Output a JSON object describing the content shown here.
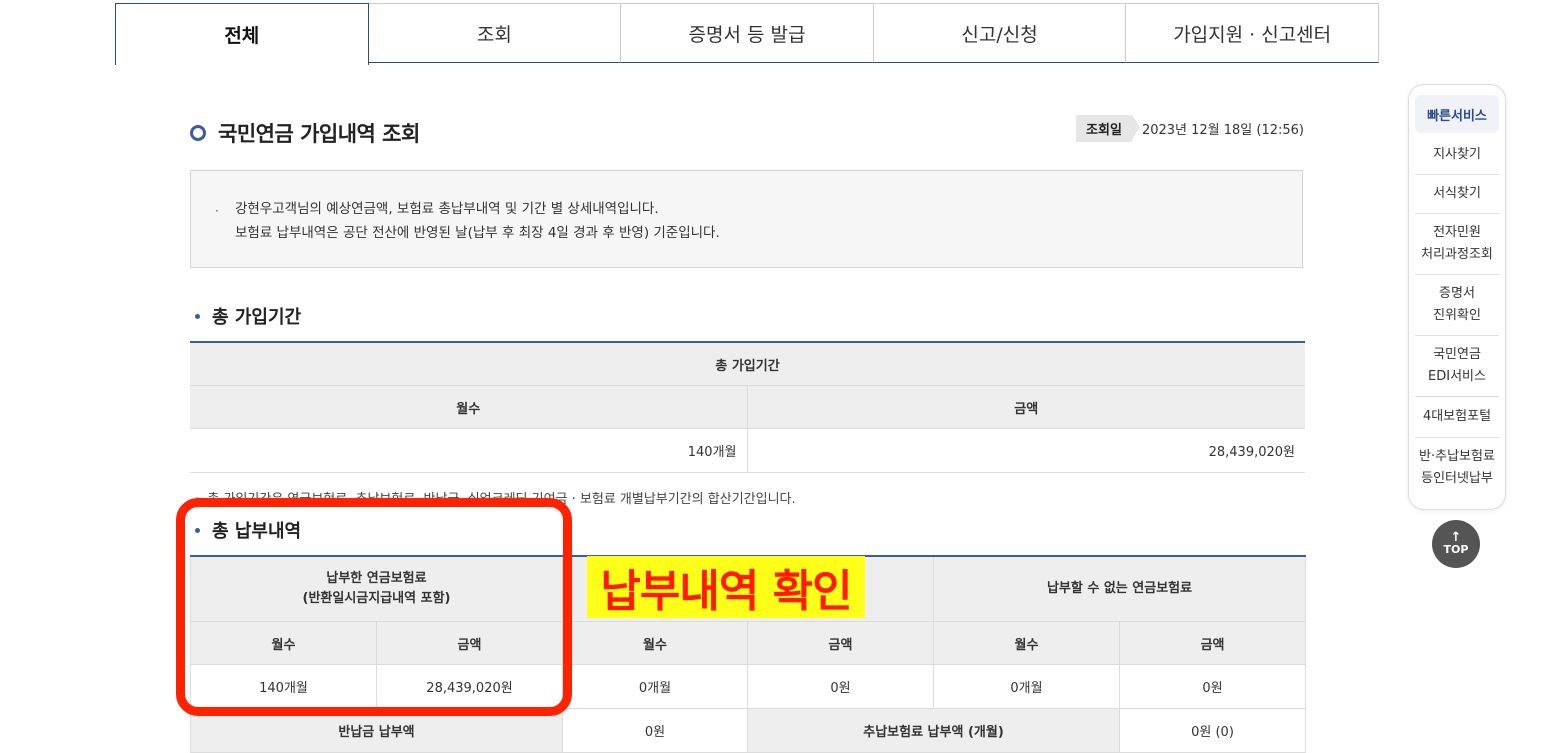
{
  "tabs": [
    "전체",
    "조회",
    "증명서 등 발급",
    "신고/신청",
    "가입지원 · 신고센터"
  ],
  "page_title": "국민연금 가입내역 조회",
  "date": {
    "badge": "조회일",
    "value": "2023년 12월 18일 (12:56)"
  },
  "info": {
    "bullet": "·",
    "line1": "강현우고객님의 예상연금액, 보험료 총납부내역 및 기간 별 상세내역입니다.",
    "line2": "보험료 납부내역은 공단 전산에 반영된 날(납부 후 최장 4일 경과 후 반영) 기준입니다."
  },
  "section1": {
    "heading": "총 가입기간",
    "table_header": "총 가입기간",
    "col_months": "월수",
    "col_amount": "금액",
    "months": "140개월",
    "amount": "28,439,020원",
    "note": "총 가입기간은 연금보험료, 추납보험료, 반납금, 실업크레딧 기여금 · 보험료 개별납부기간의 합산기간입니다."
  },
  "section2": {
    "heading": "총 납부내역",
    "group1_l1": "납부한 연금보험료",
    "group1_l2": "(반환일시금지급내역 포함)",
    "group2": "",
    "group3": "납부할 수 없는 연금보험료",
    "col_months": "월수",
    "col_amount": "금액",
    "row": [
      "140개월",
      "28,439,020원",
      "0개월",
      "0원",
      "0개월",
      "0원"
    ],
    "return_label": "반납금 납부액",
    "return_value": "0원",
    "late_label": "추납보험료 납부액 (개월)",
    "late_value": "0원 (0)"
  },
  "quick_menu": {
    "title": "빠른서비스",
    "items": [
      [
        "지사찾기"
      ],
      [
        "서식찾기"
      ],
      [
        "전자민원",
        "처리과정조회"
      ],
      [
        "증명서",
        "진위확인"
      ],
      [
        "국민연금",
        "EDI서비스"
      ],
      [
        "4대보험포털"
      ],
      [
        "반·추납보험료",
        "등인터넷납부"
      ]
    ],
    "top_label": "TOP",
    "top_arrow": "↑"
  },
  "annotation": {
    "label": "납부내역 확인",
    "color": "#ff2200",
    "highlight": "#ffff1a"
  }
}
